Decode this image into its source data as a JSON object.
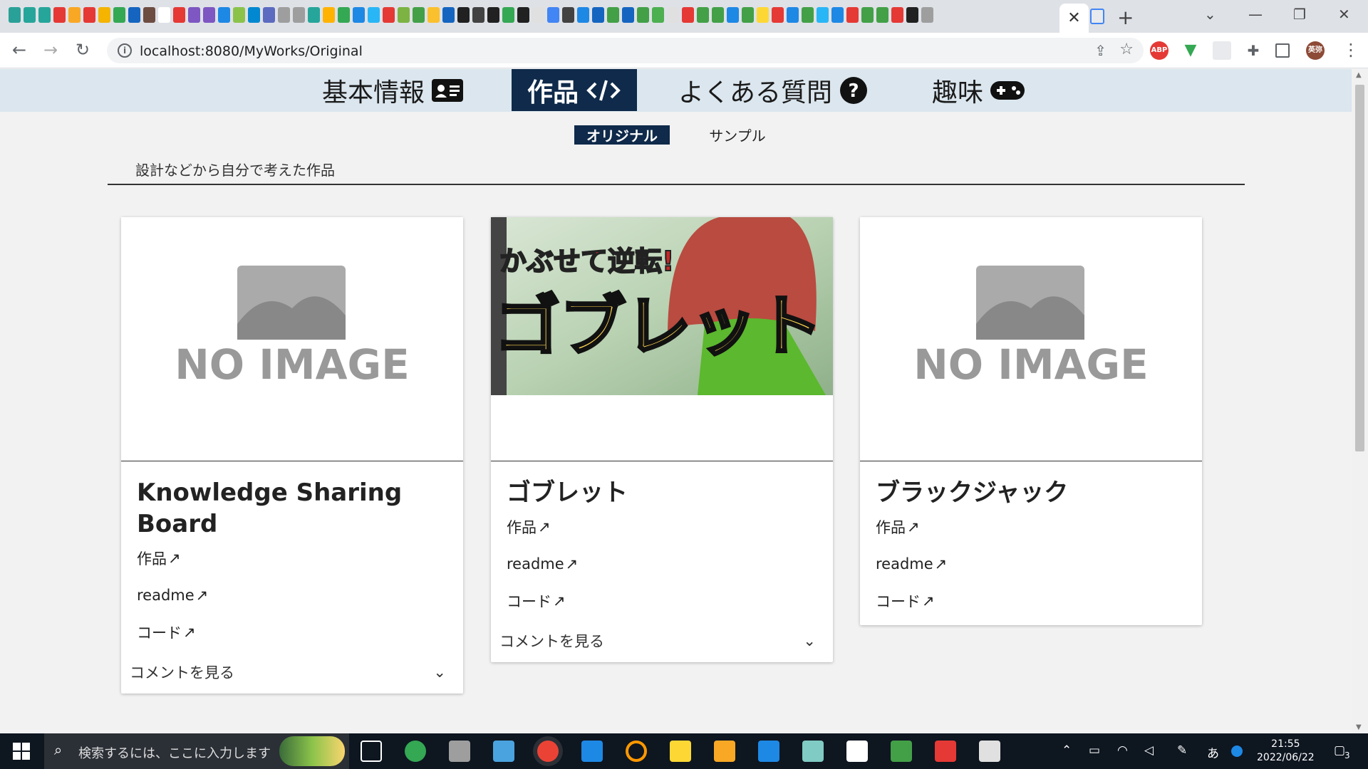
{
  "browser": {
    "url": "localhost:8080/MyWorks/Original",
    "active_tab_icon": "close-icon",
    "profile_initials": "英弥",
    "abp_label": "ABP",
    "pinned_tab_colors": [
      "#2aa198",
      "#26a69a",
      "#26a69a",
      "#e53935",
      "#f9a825",
      "#e53935",
      "#f4b400",
      "#34a853",
      "#1565c0",
      "#6d4c41",
      "#ffffff",
      "#e53935",
      "#7e57c2",
      "#7e57c2",
      "#1e88e5",
      "#8bc34a",
      "#0288d1",
      "#5c6bc0",
      "#9e9e9e",
      "#9e9e9e",
      "#26a69a",
      "#ffb300",
      "#34a853",
      "#1e88e5",
      "#29b6f6",
      "#e53935",
      "#7cb342",
      "#43a047",
      "#fbc02d",
      "#1565c0",
      "#212121",
      "#424242",
      "#212121",
      "#34a853",
      "#212121",
      "#e0e0e0",
      "#4285f4",
      "#424242",
      "#1e88e5",
      "#1565c0",
      "#43a047",
      "#1565c0",
      "#43a047",
      "#4caf50",
      "#e0e0e0",
      "#e53935",
      "#43a047",
      "#43a047",
      "#1e88e5",
      "#43a047",
      "#fdd835",
      "#e53935",
      "#1e88e5",
      "#43a047",
      "#29b6f6",
      "#1e88e5",
      "#e53935",
      "#43a047",
      "#43a047",
      "#e53935",
      "#212121",
      "#9e9e9e"
    ]
  },
  "nav": {
    "items": [
      {
        "label": "基本情報",
        "icon": "id-card-icon"
      },
      {
        "label": "作品",
        "icon": "code-icon"
      },
      {
        "label": "よくある質問",
        "icon": "question-circle-icon"
      },
      {
        "label": "趣味",
        "icon": "gamepad-icon"
      }
    ],
    "active": "作品"
  },
  "subnav": {
    "items": [
      "オリジナル",
      "サンプル"
    ],
    "active": "オリジナル"
  },
  "description": "設計などから自分で考えた作品",
  "cards": [
    {
      "title": "Knowledge Sharing Board",
      "image": "NO IMAGE",
      "links": [
        "作品",
        "readme",
        "コード"
      ],
      "comments": "コメントを見る"
    },
    {
      "title": "ゴブレット",
      "image_caption_top": "かぶせて逆転!",
      "image_caption_main": "ゴブレット",
      "links": [
        "作品",
        "readme",
        "コード"
      ],
      "comments": "コメントを見る"
    },
    {
      "title": "ブラックジャック",
      "image": "NO IMAGE",
      "links": [
        "作品",
        "readme",
        "コード"
      ]
    }
  ],
  "taskbar": {
    "search_placeholder": "検索するには、ここに入力します",
    "time": "21:55",
    "date": "2022/06/22",
    "ime": "あ",
    "notifications": "3"
  }
}
